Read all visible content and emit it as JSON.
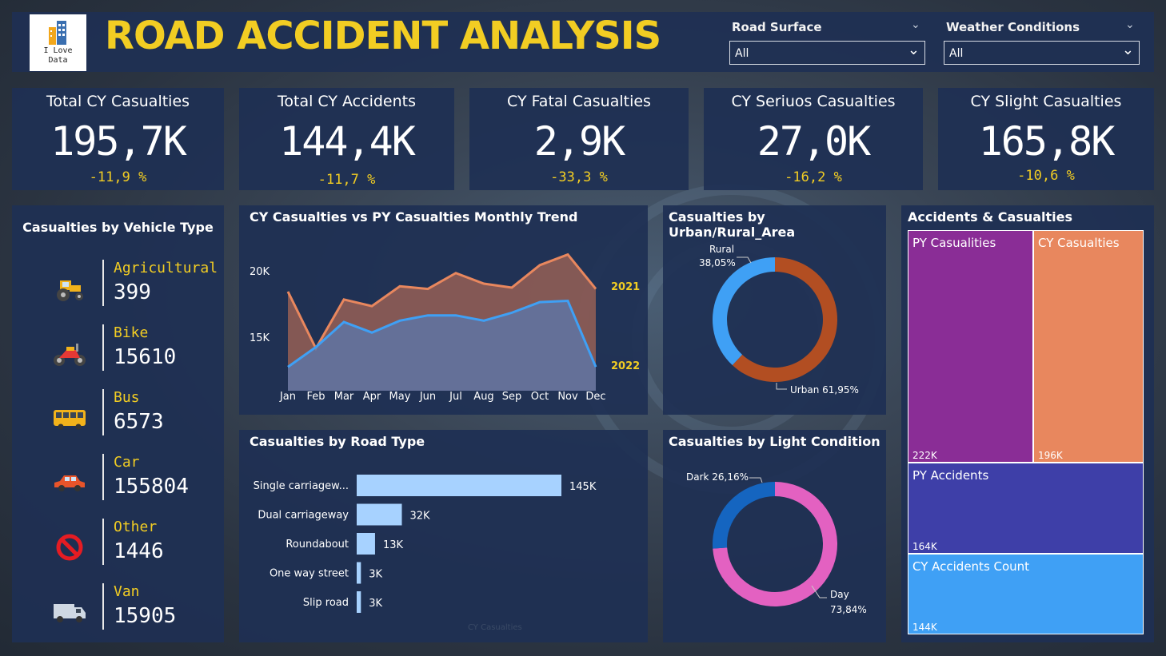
{
  "header": {
    "title": "ROAD ACCIDENT ANALYSIS",
    "logo_text": [
      "I Love",
      "Data"
    ],
    "filters": [
      {
        "label": "Road Surface",
        "value": "All"
      },
      {
        "label": "Weather Conditions",
        "value": "All"
      }
    ]
  },
  "kpis": [
    {
      "title": "Total CY Casualties",
      "value": "195,7K",
      "delta": "-11,9 %"
    },
    {
      "title": "Total CY Accidents",
      "value": "144,4K",
      "delta": "-11,7 %"
    },
    {
      "title": "CY Fatal Casualties",
      "value": "2,9K",
      "delta": "-33,3 %"
    },
    {
      "title": "CY Seriuos Casualties",
      "value": "27,0K",
      "delta": "-16,2 %"
    },
    {
      "title": "CY Slight Casualties",
      "value": "165,8K",
      "delta": "-10,6 %"
    }
  ],
  "vehicles": {
    "title": "Casualties by Vehicle Type",
    "items": [
      {
        "name": "Agricultural",
        "value": "399",
        "icon": "tractor-icon"
      },
      {
        "name": "Bike",
        "value": "15610",
        "icon": "motorbike-icon"
      },
      {
        "name": "Bus",
        "value": "6573",
        "icon": "bus-icon"
      },
      {
        "name": "Car",
        "value": "155804",
        "icon": "car-icon"
      },
      {
        "name": "Other",
        "value": "1446",
        "icon": "prohibited-icon"
      },
      {
        "name": "Van",
        "value": "15905",
        "icon": "van-icon"
      }
    ]
  },
  "trend": {
    "title": "CY Casualties vs PY Casualties Monthly Trend",
    "chart_data": {
      "type": "area",
      "x": [
        "Jan",
        "Feb",
        "Mar",
        "Apr",
        "May",
        "Jun",
        "Jul",
        "Aug",
        "Sep",
        "Oct",
        "Nov",
        "Dec"
      ],
      "ytick_labels": [
        "15K",
        "20K"
      ],
      "ylim": [
        11000,
        22000
      ],
      "series": [
        {
          "name": "2021",
          "color": "#e8875e",
          "values": [
            18500,
            14200,
            17900,
            17400,
            18900,
            18700,
            19900,
            19100,
            18800,
            20500,
            21300,
            18700
          ]
        },
        {
          "name": "2022",
          "color": "#3fa0f5",
          "values": [
            12800,
            14300,
            16200,
            15400,
            16300,
            16700,
            16700,
            16300,
            16900,
            17700,
            17800,
            12800
          ]
        }
      ]
    }
  },
  "urban": {
    "title": "Casualties by Urban/Rural_Area",
    "chart_data": {
      "type": "pie",
      "donut": true,
      "slices": [
        {
          "label": "Rural",
          "pct": "38,05%",
          "value": 38.05,
          "color": "#3fa0f5"
        },
        {
          "label": "Urban",
          "pct": "61,95%",
          "value": 61.95,
          "color": "#b24e22"
        }
      ]
    }
  },
  "roadtype": {
    "title": "Casualties by Road Type",
    "axis_title": "CY Casualties",
    "chart_data": {
      "type": "bar",
      "orientation": "horizontal",
      "categories": [
        "Single carriagew...",
        "Dual carriageway",
        "Roundabout",
        "One way street",
        "Slip road"
      ],
      "values": [
        145000,
        32000,
        13000,
        3000,
        3000
      ],
      "value_labels": [
        "145K",
        "32K",
        "13K",
        "3K",
        "3K"
      ],
      "xlim": [
        0,
        145000
      ],
      "color": "#a7d2ff"
    }
  },
  "light": {
    "title": "Casualties by Light Condition",
    "chart_data": {
      "type": "pie",
      "donut": true,
      "slices": [
        {
          "label": "Dark",
          "pct": "26,16%",
          "value": 26.16,
          "color": "#1565c0"
        },
        {
          "label": "Day",
          "pct": "73,84%",
          "value": 73.84,
          "color": "#e361c1"
        }
      ]
    }
  },
  "treemap": {
    "title": "Accidents & Casualties",
    "chart_data": {
      "type": "treemap",
      "cells": [
        {
          "label": "PY Casualities",
          "value": "222K",
          "color": "#8a2d96"
        },
        {
          "label": "CY Casualties",
          "value": "196K",
          "color": "#e8875e"
        },
        {
          "label": "PY Accidents",
          "value": "164K",
          "color": "#3e3fa8"
        },
        {
          "label": "CY Accidents Count",
          "value": "144K",
          "color": "#3fa0f5"
        }
      ]
    }
  }
}
